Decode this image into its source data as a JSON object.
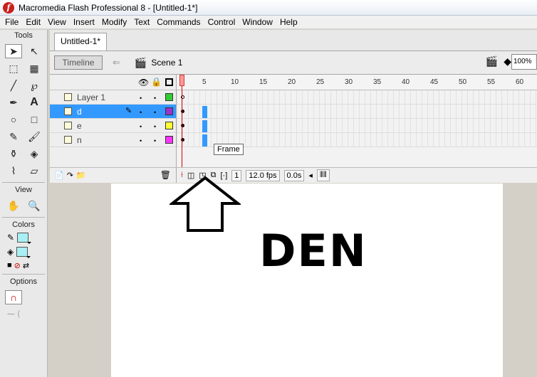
{
  "window": {
    "title": "Macromedia Flash Professional 8 - [Untitled-1*]",
    "app_icon": "f"
  },
  "menu": [
    "File",
    "Edit",
    "View",
    "Insert",
    "Modify",
    "Text",
    "Commands",
    "Control",
    "Window",
    "Help"
  ],
  "tools_panel": {
    "tools_label": "Tools",
    "view_label": "View",
    "colors_label": "Colors",
    "options_label": "Options",
    "tools": [
      "arrow-tool",
      "subselect-tool",
      "free-transform-tool",
      "fill-transform-tool",
      "line-tool",
      "lasso-tool",
      "pen-tool",
      "text-tool",
      "oval-tool",
      "rectangle-tool",
      "pencil-tool",
      "brush-tool",
      "ink-bottle-tool",
      "paint-bucket-tool",
      "eyedropper-tool",
      "eraser-tool"
    ],
    "stroke_color": "#a8f0f4",
    "fill_color": "#a8f0f4"
  },
  "document": {
    "tab": "Untitled-1*",
    "timeline_button": "Timeline",
    "scene": "Scene 1",
    "zoom": "100%"
  },
  "timeline": {
    "ruler_labels": [
      "1",
      "5",
      "10",
      "15",
      "20",
      "25",
      "30",
      "35",
      "40",
      "45",
      "50",
      "55",
      "60"
    ],
    "layers": [
      {
        "name": "Layer 1",
        "color": "#33cc33",
        "selected": false
      },
      {
        "name": "d",
        "color": "#9933cc",
        "selected": true
      },
      {
        "name": "e",
        "color": "#ffff33",
        "selected": false
      },
      {
        "name": "n",
        "color": "#ff33ff",
        "selected": false
      }
    ],
    "current_frame": "1",
    "frame_rate": "12.0 fps",
    "elapsed": "0.0s",
    "tooltip": "Frame"
  },
  "stage": {
    "text": "DEN"
  }
}
